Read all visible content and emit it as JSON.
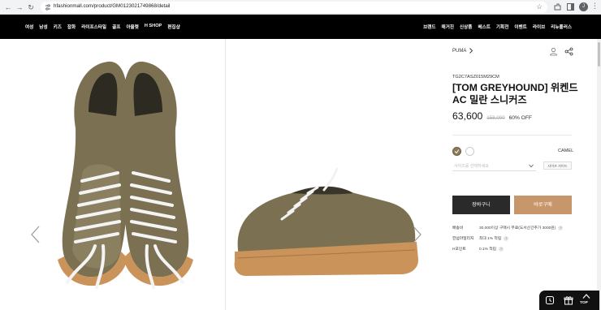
{
  "browser": {
    "url": "hfashionmall.com/product/GM0123021749868/detail",
    "profile_initial": "J"
  },
  "nav": {
    "left": [
      "여성",
      "남성",
      "키즈",
      "잡화",
      "라이프스타일",
      "골프",
      "아울렛",
      "H SHOP",
      "편집샵"
    ],
    "right": [
      "브랜드",
      "매거진",
      "신상품",
      "베스트",
      "기획전",
      "이벤트",
      "라이브",
      "리뉴플러스"
    ]
  },
  "product": {
    "brand": "PUMA",
    "code": "TG2C7ASZ015M29CM",
    "title": "[TOM GREYHOUND] 위켄드 AC 밀란 스니커즈",
    "price": "63,600",
    "original_price": "158,000",
    "discount": "60% OFF",
    "color_name": "CAMEL",
    "size_placeholder": "사이즈를 선택하세요",
    "size_guide": "사이즈 가이드",
    "cart_label": "장바구니",
    "buy_label": "바로구매"
  },
  "info": [
    {
      "label": "배송비",
      "value": "30,000이상 구매시 무료(도서산간추가 3000원)"
    },
    {
      "label": "한섬마일리지",
      "value": "최대 1% 적립"
    },
    {
      "label": "H포인트",
      "value": "0.1% 적립"
    }
  ],
  "dock": {
    "top_label": "TOP"
  },
  "colors": {
    "nav_bg": "#000000",
    "buy_btn": "#c8966b",
    "cart_btn": "#2a2a2a",
    "swatch": "#8a7a58"
  }
}
